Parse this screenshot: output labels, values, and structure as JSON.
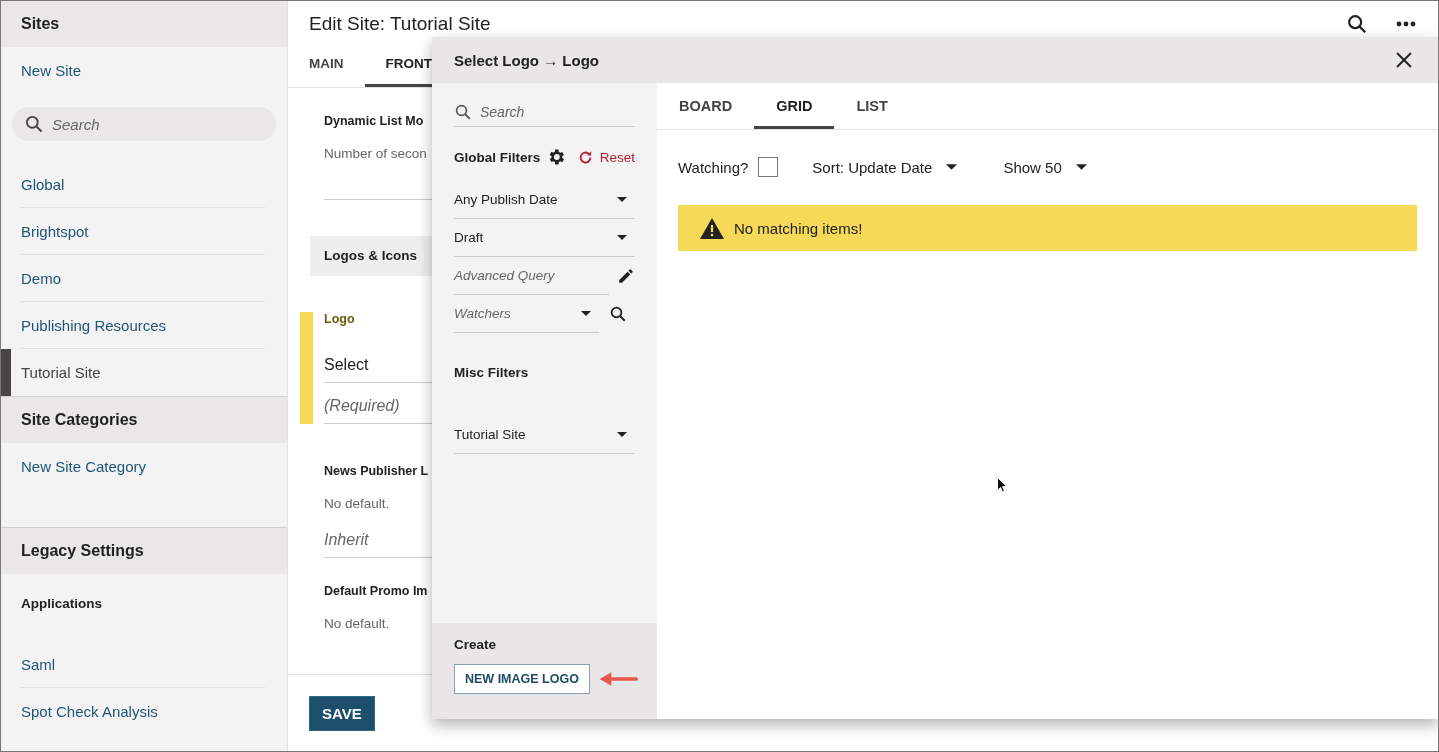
{
  "sidebar": {
    "sections": [
      {
        "title": "Sites",
        "new_link": "New Site",
        "search": {
          "placeholder": "Search"
        },
        "items": [
          {
            "label": "Global",
            "selected": false
          },
          {
            "label": "Brightspot",
            "selected": false
          },
          {
            "label": "Demo",
            "selected": false
          },
          {
            "label": "Publishing Resources",
            "selected": false
          },
          {
            "label": "Tutorial Site",
            "selected": true
          }
        ]
      },
      {
        "title": "Site Categories",
        "new_link": "New Site Category"
      },
      {
        "title": "Legacy Settings",
        "subheading": "Applications",
        "items": [
          {
            "label": "Saml",
            "selected": false
          },
          {
            "label": "Spot Check Analysis",
            "selected": false
          }
        ]
      }
    ]
  },
  "main": {
    "title": "Edit Site: Tutorial Site",
    "tabs": [
      {
        "label": "MAIN",
        "selected": false
      },
      {
        "label": "FRONT",
        "selected": true
      }
    ],
    "fields": [
      {
        "kind": "text",
        "label": "Dynamic List Mo",
        "hint": "Number of secon"
      },
      {
        "kind": "section",
        "label": "Logos & Icons"
      },
      {
        "kind": "required",
        "label": "Logo",
        "value": "Select",
        "placeholder": "(Required)"
      },
      {
        "kind": "select",
        "label": "News Publisher L",
        "hint": "No default.",
        "placeholder": "Inherit"
      },
      {
        "kind": "select",
        "label": "Default Promo Im",
        "hint": "No default."
      }
    ],
    "save": "SAVE"
  },
  "modal": {
    "title": "Select Logo → Logo",
    "search": {
      "placeholder": "Search"
    },
    "global_filters": {
      "title": "Global Filters",
      "reset": "Reset",
      "filters": [
        {
          "kind": "select",
          "value": "Any Publish Date"
        },
        {
          "kind": "select",
          "value": "Draft"
        },
        {
          "kind": "query",
          "placeholder": "Advanced Query"
        },
        {
          "kind": "watchers",
          "placeholder": "Watchers"
        }
      ]
    },
    "misc_filters": {
      "title": "Misc Filters",
      "filters": [
        {
          "kind": "select",
          "value": "Tutorial Site"
        }
      ]
    },
    "create": {
      "title": "Create",
      "button": "NEW IMAGE LOGO"
    },
    "view_tabs": [
      {
        "label": "BOARD",
        "selected": false
      },
      {
        "label": "GRID",
        "selected": true
      },
      {
        "label": "LIST",
        "selected": false
      }
    ],
    "toolbar": {
      "watching_label": "Watching?",
      "watching": false,
      "sort": "Sort: Update Date",
      "show": "Show 50"
    },
    "alert": "No matching items!"
  }
}
